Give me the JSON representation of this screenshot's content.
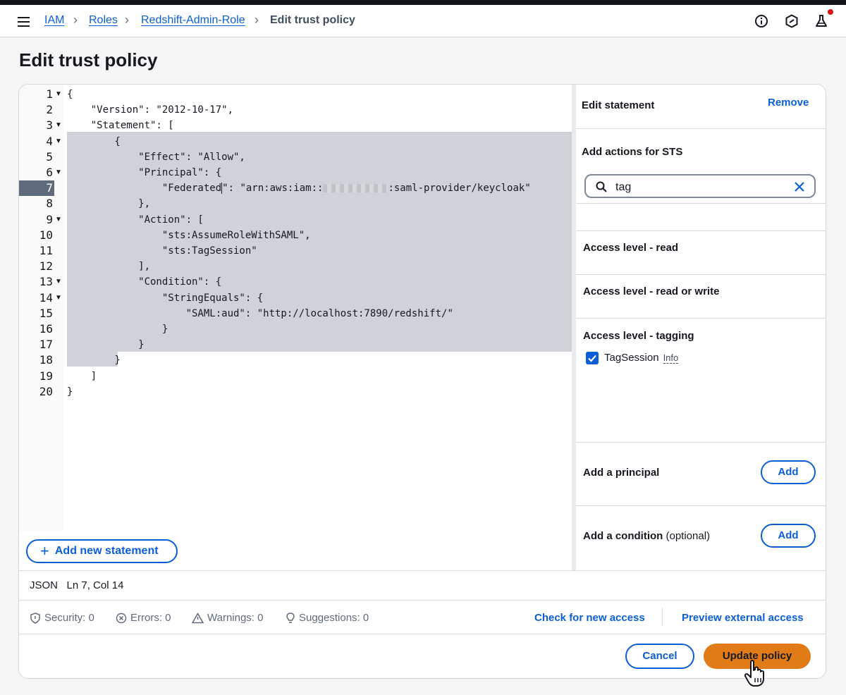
{
  "breadcrumb": {
    "items": [
      "IAM",
      "Roles",
      "Redshift-Admin-Role"
    ],
    "current": "Edit trust policy"
  },
  "header_icons": [
    "info-icon",
    "settings-hexagon-icon",
    "flask-icon"
  ],
  "page": {
    "title": "Edit trust policy"
  },
  "editor": {
    "lines": [
      {
        "n": "1",
        "text": "{"
      },
      {
        "n": "2",
        "text": "    \"Version\": \"2012-10-17\","
      },
      {
        "n": "3",
        "text": "    \"Statement\": ["
      },
      {
        "n": "4",
        "text": "        {"
      },
      {
        "n": "5",
        "text": "            \"Effect\": \"Allow\","
      },
      {
        "n": "6",
        "text": "            \"Principal\": {"
      },
      {
        "n": "7",
        "text_pre": "                \"Federated",
        "text_mid": "\": \"arn:aws:iam::",
        "text_post": ":saml-provider/keycloak\""
      },
      {
        "n": "8",
        "text": "            },"
      },
      {
        "n": "9",
        "text": "            \"Action\": ["
      },
      {
        "n": "10",
        "text": "                \"sts:AssumeRoleWithSAML\","
      },
      {
        "n": "11",
        "text": "                \"sts:TagSession\""
      },
      {
        "n": "12",
        "text": "            ],"
      },
      {
        "n": "13",
        "text": "            \"Condition\": {"
      },
      {
        "n": "14",
        "text": "                \"StringEquals\": {"
      },
      {
        "n": "15",
        "text": "                    \"SAML:aud\": \"http://localhost:7890/redshift/\""
      },
      {
        "n": "16",
        "text": "                }"
      },
      {
        "n": "17",
        "text": "            }"
      },
      {
        "n": "18",
        "text": "        }"
      },
      {
        "n": "19",
        "text": "    ]"
      },
      {
        "n": "20",
        "text": "}"
      }
    ],
    "add_statement_label": "Add new statement"
  },
  "side_panel": {
    "title": "Edit statement",
    "remove_label": "Remove",
    "actions_title": "Add actions for STS",
    "search_value": "tag",
    "access_levels": [
      "Access level - read",
      "Access level - read or write",
      "Access level - tagging"
    ],
    "checkbox_label": "TagSession",
    "info_label": "Info",
    "principal_title": "Add a principal",
    "condition_title": "Add a condition",
    "condition_optional": "(optional)",
    "add_label": "Add"
  },
  "status": {
    "format": "JSON",
    "position": "Ln 7, Col 14"
  },
  "validation": {
    "security": "Security: 0",
    "errors": "Errors: 0",
    "warnings": "Warnings: 0",
    "suggestions": "Suggestions: 0",
    "check_new_access": "Check for new access",
    "preview_external_access": "Preview external access"
  },
  "footer": {
    "cancel_label": "Cancel",
    "update_label": "Update policy"
  },
  "colors": {
    "accent": "#0b5ed7",
    "primary_button": "#e07b18",
    "selection": "#cfd2d6"
  }
}
